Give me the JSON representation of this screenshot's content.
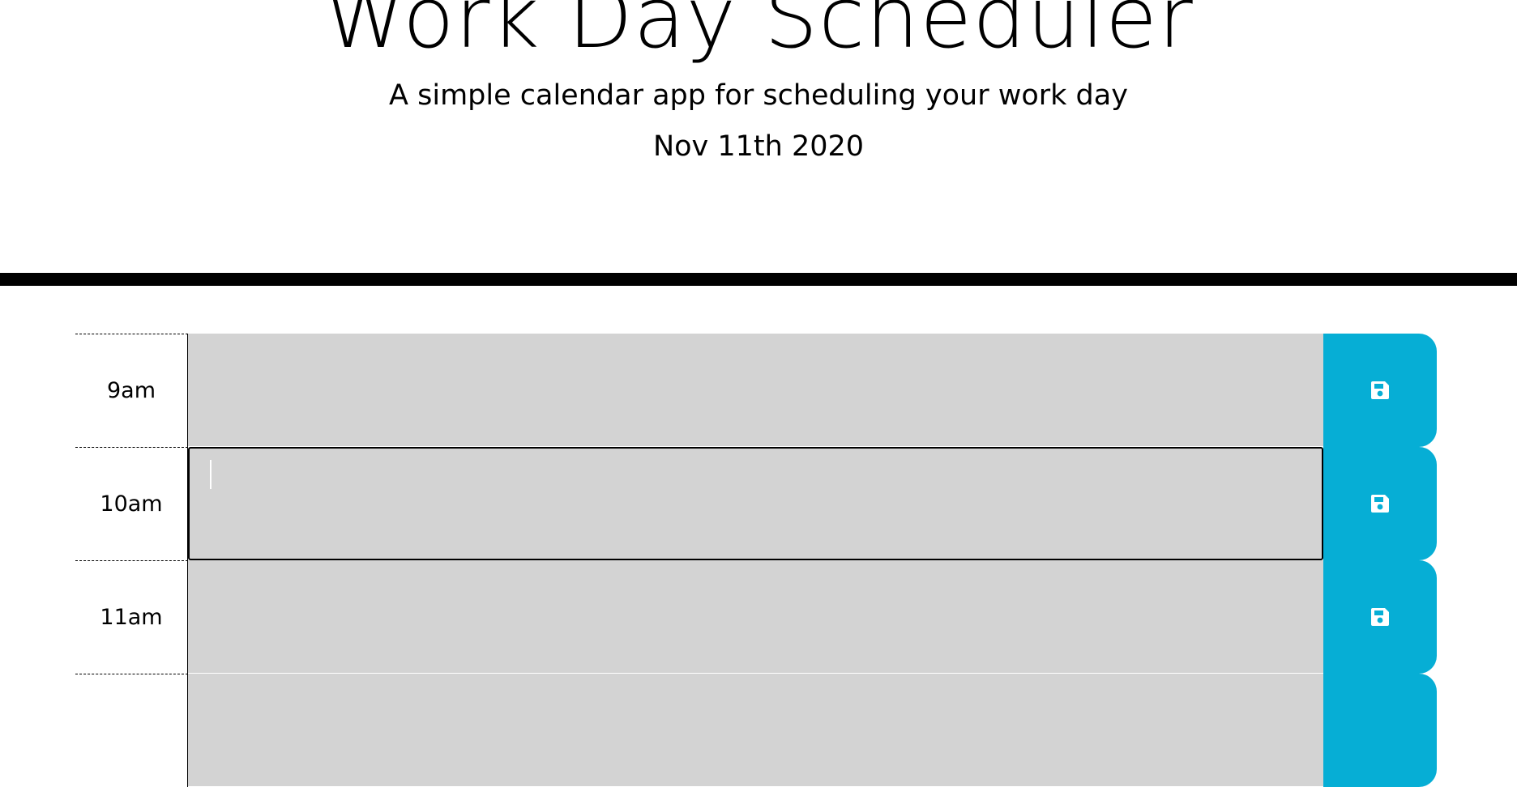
{
  "header": {
    "title": "Work Day Scheduler",
    "subtitle": "A simple calendar app for scheduling your work day",
    "current_day": "Nov 11th 2020"
  },
  "rows": [
    {
      "hour": "9am",
      "text": ""
    },
    {
      "hour": "10am",
      "text": ""
    },
    {
      "hour": "11am",
      "text": ""
    },
    {
      "hour": "",
      "text": ""
    }
  ],
  "colors": {
    "past": "#d3d3d3",
    "save_button": "#06aed5",
    "header_border": "#000000"
  },
  "icons": {
    "save": "floppy-disk-icon"
  }
}
